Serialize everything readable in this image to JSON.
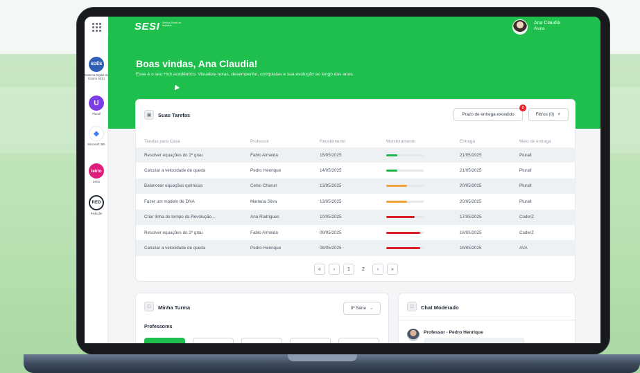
{
  "colors": {
    "brand_green": "#1fbf4e",
    "progress_green": "#22b24c",
    "progress_orange": "#f0a03a",
    "progress_red": "#d81f26"
  },
  "topbar": {
    "logo_text": "SESI",
    "logo_subtext": "Serviço Social da Indústria",
    "user_name": "Ana Claudia",
    "user_role": "Aluna",
    "apps_icon": "grid-icon"
  },
  "sidebar": {
    "items": [
      {
        "icon_text": "SDÊS",
        "label": "Sistema Digital de Ensino SESI",
        "color": "#2f5fb3"
      },
      {
        "icon_text": "U",
        "label": "Plurall",
        "color": "#7b3fe4"
      },
      {
        "icon_text": "◆",
        "label": "Microsoft 365",
        "color": "#ffffff"
      },
      {
        "icon_text": "lekto",
        "label": "Lekto",
        "color": "#e11d7b"
      },
      {
        "icon_text": "RED",
        "label": "Redação",
        "color": "#ffffff"
      }
    ]
  },
  "hero": {
    "title": "Boas vindas, Ana Claudia!",
    "subtitle": "Esse é o seu Hub acadêmico. Visualize notas, desempenho, conquistas e sua evolução ao longo dos anos."
  },
  "tasks": {
    "title": "Suas Tarefas",
    "deadline_button": "Prazo de entrega excedido",
    "deadline_badge": "2",
    "filters_button": "Filtros (0)",
    "columns": [
      "Tarefas para Casa",
      "Professor",
      "Recebimento",
      "Monitoramento",
      "Entrega",
      "Meio de entrega"
    ],
    "rows": [
      {
        "task": "Resolver equações do 2º grau",
        "teacher": "Fabio Almeida",
        "received": "15/05/2025",
        "progress": 0.3,
        "status": "green",
        "due": "21/05/2025",
        "channel": "Plurall"
      },
      {
        "task": "Calcular a velocidade de queda",
        "teacher": "Pedro Henrique",
        "received": "14/05/2025",
        "progress": 0.3,
        "status": "green",
        "due": "21/05/2025",
        "channel": "Plurall"
      },
      {
        "task": "Balancear equações químicas",
        "teacher": "Celso Charuri",
        "received": "13/05/2025",
        "progress": 0.55,
        "status": "orange",
        "due": "20/05/2025",
        "channel": "Plurall"
      },
      {
        "task": "Fazer um modelo de DNA",
        "teacher": "Mariana Silva",
        "received": "13/05/2025",
        "progress": 0.55,
        "status": "orange",
        "due": "20/05/2025",
        "channel": "Plurall"
      },
      {
        "task": "Criar linha do tempo da Revolução...",
        "teacher": "Ana Rodrigues",
        "received": "10/05/2025",
        "progress": 0.75,
        "status": "red",
        "due": "17/05/2025",
        "channel": "CoderZ"
      },
      {
        "task": "Resolver equações do 2º grau",
        "teacher": "Fabio Almeida",
        "received": "09/05/2025",
        "progress": 0.9,
        "status": "red",
        "due": "16/05/2025",
        "channel": "CoderZ"
      },
      {
        "task": "Calcular a velocidade de queda",
        "teacher": "Pedro Henrique",
        "received": "08/05/2025",
        "progress": 0.9,
        "status": "red",
        "due": "16/05/2025",
        "channel": "AVA"
      }
    ],
    "pagination": {
      "first": "«",
      "prev": "‹",
      "pages": [
        "1",
        "2"
      ],
      "next": "›",
      "last": "»"
    }
  },
  "turma": {
    "title": "Minha Turma",
    "grade_select": "9º Série",
    "professors_label": "Professores"
  },
  "chat": {
    "title": "Chat Moderado",
    "sender": "Professor - Pedro Henrique"
  }
}
